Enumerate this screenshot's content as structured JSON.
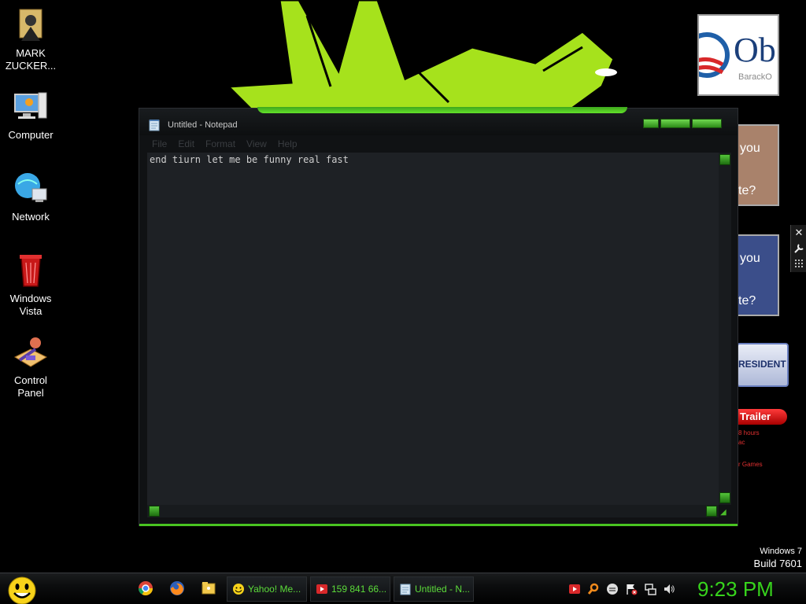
{
  "desktop": {
    "icons": [
      {
        "label": "MARK ZUCKER..."
      },
      {
        "label": "Computer"
      },
      {
        "label": "Network"
      },
      {
        "label": "Windows Vista"
      },
      {
        "label": "Control Panel"
      }
    ],
    "gadgets": {
      "obama": {
        "logo_text": "Ob",
        "sub_text": "BarackO"
      },
      "photo1": {
        "line1": "you",
        "line2": "te?"
      },
      "photo2": {
        "line1": "you",
        "line2": "te?"
      },
      "president": {
        "text": "RESIDENT"
      },
      "trailer": {
        "title": "Trailer",
        "line1": "8 hours",
        "line2": "ac",
        "line3": "r Games"
      }
    },
    "gadget_tools": {
      "close": "✕",
      "options": "🔧",
      "drag": "⋮⋮"
    }
  },
  "notepad": {
    "title": "Untitled - Notepad",
    "menu": [
      "File",
      "Edit",
      "Format",
      "View",
      "Help"
    ],
    "text": "end tiurn let me be funny real fast"
  },
  "watermark": {
    "line1": "Windows 7",
    "line2": "Build 7601"
  },
  "taskbar": {
    "tasks": [
      {
        "label": "Yahoo! Me...",
        "icon": "yahoo-messenger-icon"
      },
      {
        "label": "159 841 66...",
        "icon": "video-icon"
      },
      {
        "label": "Untitled - N...",
        "icon": "notepad-icon"
      }
    ],
    "clock": "9:23 PM"
  },
  "colors": {
    "accent": "#37d41c",
    "window_bg": "#1e2125"
  }
}
